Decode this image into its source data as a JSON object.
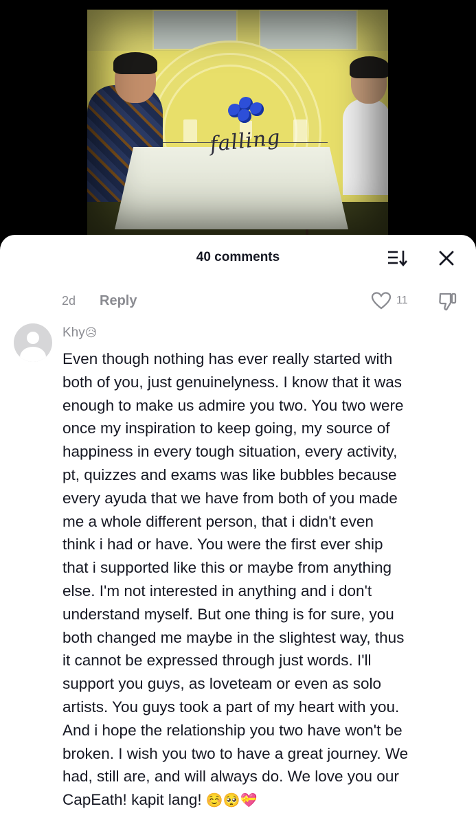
{
  "video": {
    "caption": "falling"
  },
  "comments_panel": {
    "title": "40 comments",
    "previous_comment": {
      "time": "2d",
      "reply_label": "Reply",
      "like_count": "11"
    },
    "comment": {
      "username": "Khy",
      "username_emoji": "😥",
      "text": "Even though nothing has ever really started with\nboth of you, just genuinelyness. I know that it was\nenough to make us admire you two. You two were\nonce my inspiration to keep going, my source of\nhappiness in every tough situation, every activity,\npt, quizzes and exams was like bubbles because\nevery ayuda that we have from both of you made\nme a whole different person, that i didn't even\nthink i had or have. You were the first ever ship\nthat i supported like this or maybe from anything\nelse. I'm not interested in anything and i don't\nunderstand myself. But one thing is for sure, you\nboth changed me maybe in the slightest way, thus\nit cannot be expressed through just words. I'll\nsupport you guys, as loveteam or even as solo\nartists. You guys took a part of my heart with you.\nAnd i hope the relationship you two have won't be\nbroken. I wish you two to have a great journey. We\nhad, still are, and will always do. We love you our\nCapEath! kapit lang! ",
      "trailing_emojis": "☺️🥺💝"
    }
  },
  "icons": {
    "sort": "sort-icon",
    "close": "close-icon",
    "like": "heart-outline-icon",
    "dislike": "thumbs-down-icon",
    "avatar": "default-avatar-icon"
  }
}
